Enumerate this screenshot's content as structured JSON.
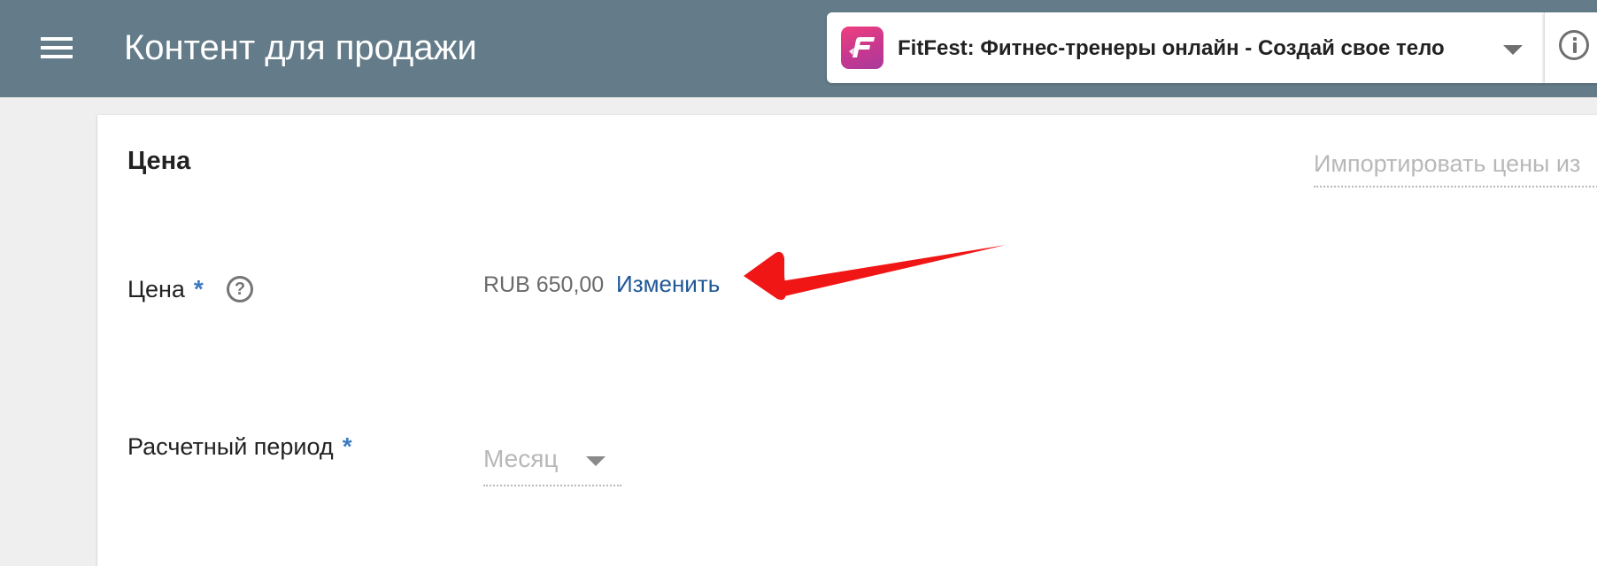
{
  "header": {
    "title": "Контент для продажи",
    "app_selector": {
      "app_name": "FitFest: Фитнес-тренеры онлайн - Создай свое тело"
    }
  },
  "section": {
    "title": "Цена",
    "import_link": "Импортировать цены из"
  },
  "fields": {
    "price": {
      "label": "Цена",
      "required_mark": "*",
      "help_glyph": "?",
      "value": "RUB 650,00",
      "edit_label": "Изменить"
    },
    "billing_period": {
      "label": "Расчетный период",
      "required_mark": "*",
      "selected": "Месяц"
    }
  },
  "colors": {
    "app_bar": "#647c89",
    "link": "#1f5796",
    "required": "#3b7bbf",
    "annotation_arrow": "#f01616"
  },
  "icons": {
    "menu": "hamburger-menu-icon",
    "app_logo": "fitfest-logo-icon",
    "dropdown": "caret-down-icon",
    "info": "info-circle-icon",
    "help": "question-circle-icon"
  }
}
